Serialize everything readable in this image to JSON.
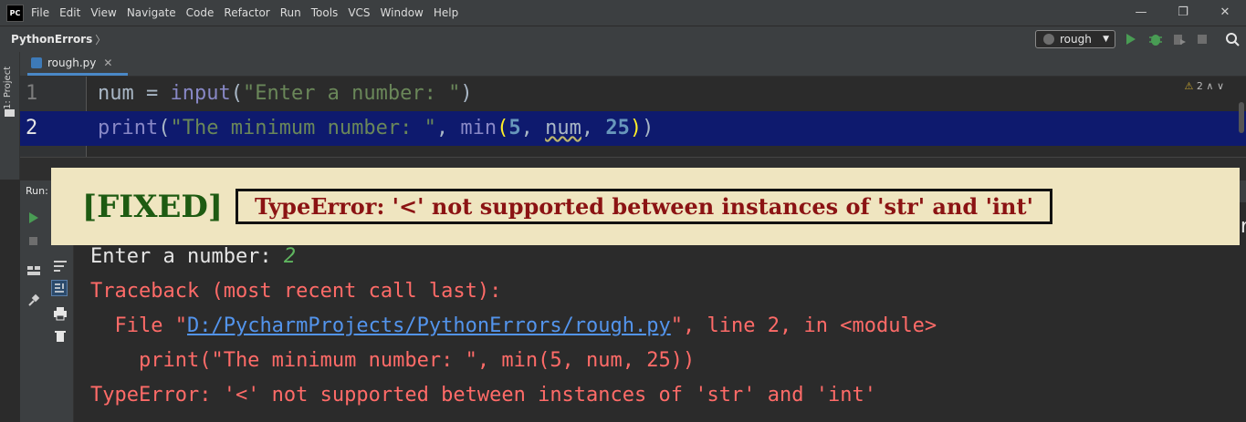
{
  "app": {
    "icon_text": "PC"
  },
  "menu": [
    "File",
    "Edit",
    "View",
    "Navigate",
    "Code",
    "Refactor",
    "Run",
    "Tools",
    "VCS",
    "Window",
    "Help"
  ],
  "window_controls": {
    "minimize": "—",
    "maximize": "❐",
    "close": "✕"
  },
  "navbar": {
    "breadcrumb": "PythonErrors",
    "breadcrumb_arrow": "〉",
    "run_config": "rough"
  },
  "left_strip": {
    "project_tab": "1: Project"
  },
  "editor_tab": {
    "file_name": "rough.py",
    "close": "✕"
  },
  "editor": {
    "inspection_count": "2",
    "lines": [
      {
        "number": "1",
        "text": "num = input(\"Enter a number: \")"
      },
      {
        "number": "2",
        "text": "print(\"The minimum number: \", min(5, num, 25))"
      }
    ]
  },
  "run_panel": {
    "label": "Run:"
  },
  "banner": {
    "tag": "[FIXED]",
    "message": "TypeError: '<' not supported between instances of 'str' and 'int'"
  },
  "console": {
    "prompt": "Enter a number: ",
    "input_value": "2",
    "traceback_header": "Traceback (most recent call last):",
    "file_prefix": "  File \"",
    "file_link": "D:/PycharmProjects/PythonErrors/rough.py",
    "file_suffix": "\", line 2, in <module>",
    "code_line": "    print(\"The minimum number: \", min(5, num, 25))",
    "error_line": "TypeError: '<' not supported between instances of 'str' and 'int'"
  },
  "colors": {
    "background": "#2b2b2b",
    "current_line": "#0e1a6e",
    "error_text": "#ff6b68",
    "banner_bg": "#efe5c0",
    "banner_fixed": "#1e5b12",
    "banner_message": "#8b1313"
  },
  "icons": {
    "run": "play-icon",
    "debug": "bug-icon",
    "coverage": "coverage-icon",
    "stop": "stop-icon",
    "search": "search-icon"
  }
}
